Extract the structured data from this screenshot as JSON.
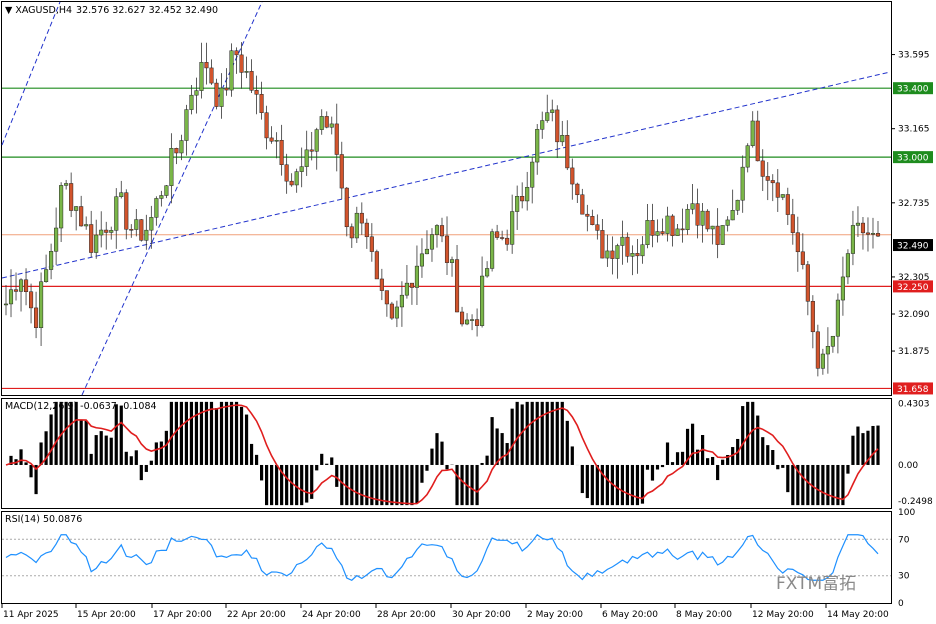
{
  "header": {
    "symbol": "XAGUSD,H4",
    "ohlc": "32.576 32.627 32.452 32.490"
  },
  "watermark": "FXTM富拓",
  "chart_data": [
    {
      "type": "candlestick",
      "title": "XAGUSD,H4",
      "ylim": [
        31.62,
        33.9
      ],
      "y_ticks": [
        "33.595",
        "33.165",
        "32.735",
        "32.305",
        "32.090",
        "31.875"
      ],
      "current_price": "32.490",
      "levels": [
        {
          "label": "33.400",
          "value": 33.4,
          "color": "#1e8c1e"
        },
        {
          "label": "33.000",
          "value": 33.0,
          "color": "#1e8c1e"
        },
        {
          "label": "32.250",
          "value": 32.25,
          "color": "#e01e1e"
        },
        {
          "label": "31.658",
          "value": 31.658,
          "color": "#e01e1e"
        }
      ],
      "bid_line_value": 32.55,
      "x_labels": [
        "11 Apr 2025",
        "15 Apr 20:00",
        "17 Apr 20:00",
        "22 Apr 20:00",
        "24 Apr 20:00",
        "28 Apr 20:00",
        "30 Apr 20:00",
        "2 May 20:00",
        "6 May 20:00",
        "8 May 20:00",
        "12 May 20:00",
        "14 May 20:00"
      ],
      "close_path": [
        32.15,
        32.35,
        32.05,
        32.4,
        32.85,
        32.7,
        32.5,
        32.62,
        32.72,
        32.55,
        32.6,
        32.85,
        33.05,
        33.4,
        33.55,
        33.3,
        33.62,
        33.45,
        33.2,
        33.1,
        32.85,
        32.95,
        33.25,
        33.1,
        32.55,
        32.7,
        32.2,
        32.0,
        32.25,
        32.45,
        32.6,
        32.4,
        32.02,
        32.1,
        32.5,
        32.55,
        32.75,
        33.1,
        33.25,
        33.05,
        32.85,
        32.55,
        32.45,
        32.55,
        32.45,
        32.6,
        32.65,
        32.6,
        32.75,
        32.6,
        32.5,
        32.7,
        33.2,
        32.95,
        32.85,
        32.6,
        32.2,
        31.75,
        32.0,
        32.5,
        32.58,
        32.49
      ],
      "macd": {
        "label": "MACD(12,26,9) -0.0637 -0.1084",
        "ylim": [
          -0.3,
          0.46
        ],
        "ticks": [
          "0.4303",
          "0.00",
          "-0.2498"
        ]
      },
      "rsi": {
        "label": "RSI(14) 50.0876",
        "ylim": [
          0,
          100
        ],
        "ticks": [
          "100",
          "70",
          "30",
          "0"
        ]
      }
    }
  ]
}
